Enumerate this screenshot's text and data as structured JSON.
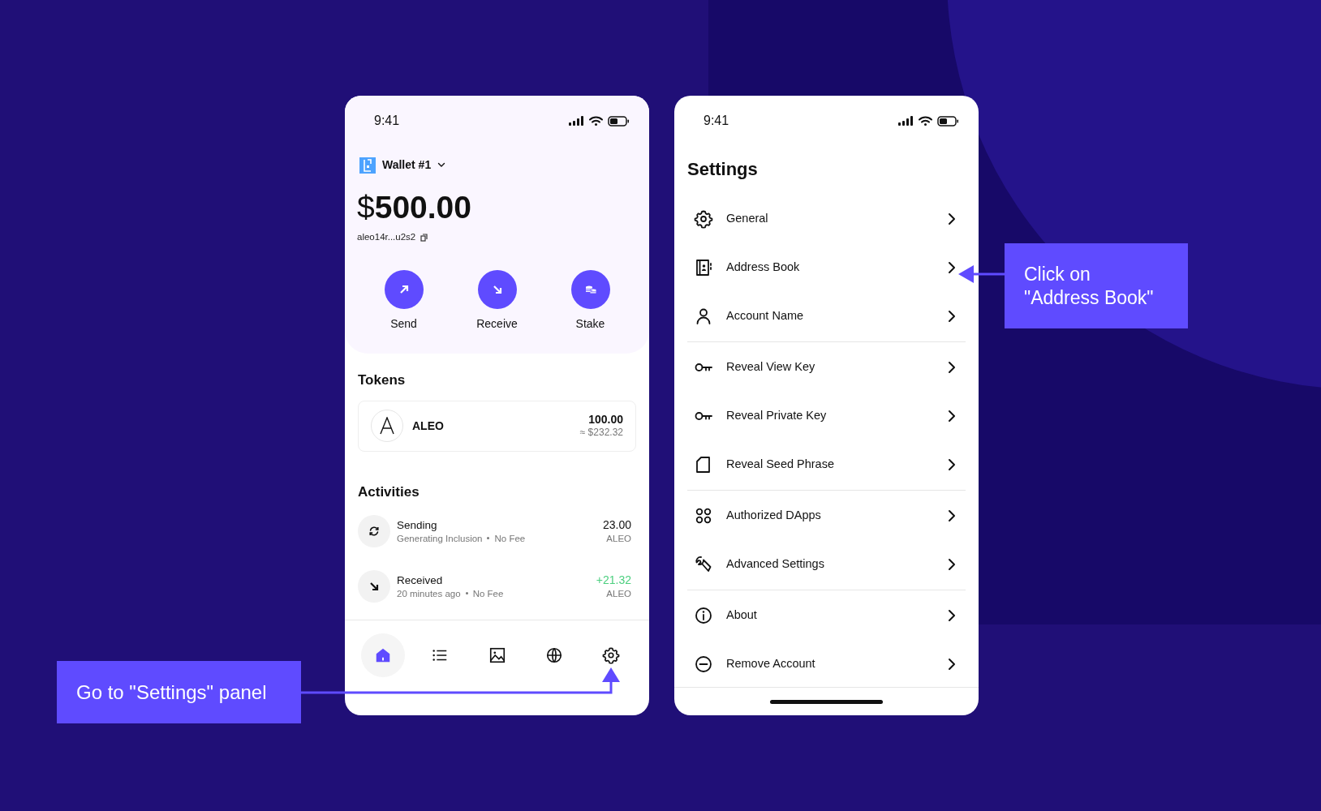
{
  "wallet_screen": {
    "status_time": "9:41",
    "wallet_name": "Wallet #1",
    "balance": "$**500.00**",
    "address": "aleo14r...u2s2",
    "actions": [
      {
        "label": "Send"
      },
      {
        "label": "Receive"
      },
      {
        "label": "Stake"
      }
    ],
    "tokens_title": "Tokens",
    "tokens": [
      {
        "symbol": "ALEO",
        "amount": "100.00",
        "value": "≈ $232.32"
      }
    ],
    "activities_title": "Activities",
    "activities": [
      {
        "kind": "pending",
        "title": "Sending",
        "detail": "Generating Inclusion",
        "fee": "No Fee",
        "amount": "23.00",
        "unit": "ALEO"
      },
      {
        "kind": "received",
        "title": "Received",
        "detail": "20 minutes ago",
        "fee": "No Fee",
        "amount": "+21.32",
        "unit": "ALEO"
      }
    ],
    "nav": [
      {
        "selected": true
      },
      {
        "selected": false
      },
      {
        "selected": false
      },
      {
        "selected": false
      },
      {
        "selected": false
      }
    ]
  },
  "settings_screen": {
    "status_time": "9:41",
    "title": "Settings",
    "groups": [
      [
        {
          "label": "General"
        },
        {
          "label": "Address Book"
        },
        {
          "label": "Account Name"
        }
      ],
      [
        {
          "label": "Reveal View Key"
        },
        {
          "label": "Reveal Private Key"
        },
        {
          "label": "Reveal Seed Phrase"
        }
      ],
      [
        {
          "label": "Authorized DApps"
        },
        {
          "label": "Advanced Settings"
        }
      ],
      [
        {
          "label": "About"
        },
        {
          "label": "Remove Account"
        }
      ]
    ]
  },
  "callouts": [
    {
      "text": "Go to \"Settings\" panel"
    },
    {
      "text": "Click on \"Address Book\""
    }
  ]
}
